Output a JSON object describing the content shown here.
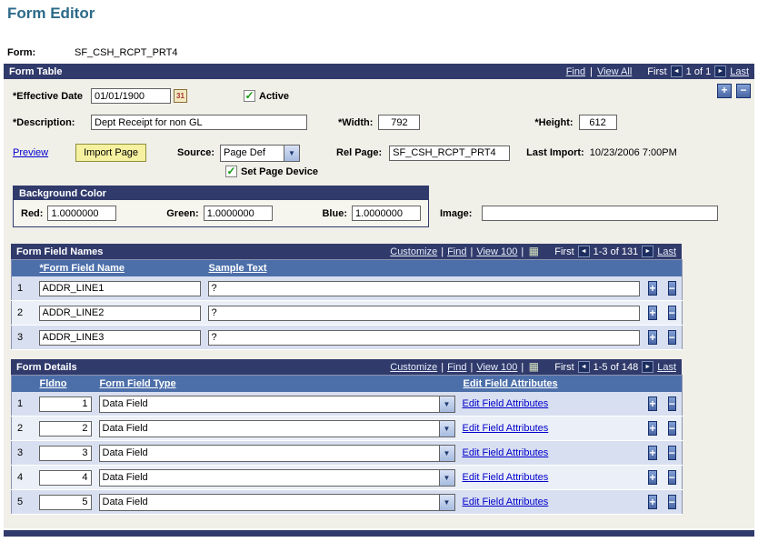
{
  "ui": {
    "sep": "|"
  },
  "icons": {
    "plus": "+",
    "minus": "−",
    "check": "✓",
    "dropdown_arrow": "▼",
    "prev_arrow": "◄",
    "next_arrow": "►",
    "grid_glyph": "▦",
    "calendar_glyph": "31"
  },
  "colors": {
    "section_header": "#303A6B",
    "grid_column_header": "#4C6FAA",
    "link_blue": "#0000CC",
    "row_odd": "#D8DFF0",
    "row_even": "#EBEFF7",
    "import_button": "#F6F1A0",
    "check_green": "#129A12",
    "title_text": "#2B6A8A"
  },
  "page": {
    "title": "Form Editor",
    "form_label": "Form:",
    "form_value": "SF_CSH_RCPT_PRT4"
  },
  "form_table": {
    "title": "Form Table",
    "nav": {
      "find": "Find",
      "view_all": "View All",
      "first": "First",
      "position": "1 of 1",
      "last": "Last"
    },
    "effective_date": {
      "label": "*Effective Date",
      "value": "01/01/1900"
    },
    "active_label": "Active",
    "description": {
      "label": "*Description:",
      "value": "Dept Receipt for non GL"
    },
    "width": {
      "label": "*Width:",
      "value": "792"
    },
    "height": {
      "label": "*Height:",
      "value": "612"
    },
    "preview_link": "Preview",
    "import_button": "Import Page",
    "source": {
      "label": "Source:",
      "value": "Page Def"
    },
    "rel_page": {
      "label": "Rel Page:",
      "value": "SF_CSH_RCPT_PRT4"
    },
    "last_import": {
      "label": "Last Import:",
      "value": "10/23/2006 7:00PM"
    },
    "set_page_device_label": "Set Page Device",
    "background_color": {
      "title": "Background Color",
      "red": {
        "label": "Red:",
        "value": "1.0000000"
      },
      "green": {
        "label": "Green:",
        "value": "1.0000000"
      },
      "blue": {
        "label": "Blue:",
        "value": "1.0000000"
      }
    },
    "image": {
      "label": "Image:",
      "value": ""
    }
  },
  "form_field_names": {
    "title": "Form Field Names",
    "toolbar": {
      "customize": "Customize",
      "find": "Find",
      "view": "View 100",
      "first": "First",
      "position": "1-3 of 131",
      "last": "Last"
    },
    "columns": {
      "name": "*Form Field Name",
      "sample": "Sample Text"
    },
    "rows": [
      {
        "num": "1",
        "name": "ADDR_LINE1",
        "sample": "?"
      },
      {
        "num": "2",
        "name": "ADDR_LINE2",
        "sample": "?"
      },
      {
        "num": "3",
        "name": "ADDR_LINE3",
        "sample": "?"
      }
    ]
  },
  "form_details": {
    "title": "Form Details",
    "toolbar": {
      "customize": "Customize",
      "find": "Find",
      "view": "View 100",
      "first": "First",
      "position": "1-5 of 148",
      "last": "Last"
    },
    "columns": {
      "fldno": "Fldno",
      "type": "Form Field Type",
      "attrs": "Edit Field Attributes"
    },
    "rows": [
      {
        "num": "1",
        "fldno": "1",
        "type": "Data Field",
        "link": "Edit Field Attributes"
      },
      {
        "num": "2",
        "fldno": "2",
        "type": "Data Field",
        "link": "Edit Field Attributes"
      },
      {
        "num": "3",
        "fldno": "3",
        "type": "Data Field",
        "link": "Edit Field Attributes"
      },
      {
        "num": "4",
        "fldno": "4",
        "type": "Data Field",
        "link": "Edit Field Attributes"
      },
      {
        "num": "5",
        "fldno": "5",
        "type": "Data Field",
        "link": "Edit Field Attributes"
      }
    ]
  }
}
